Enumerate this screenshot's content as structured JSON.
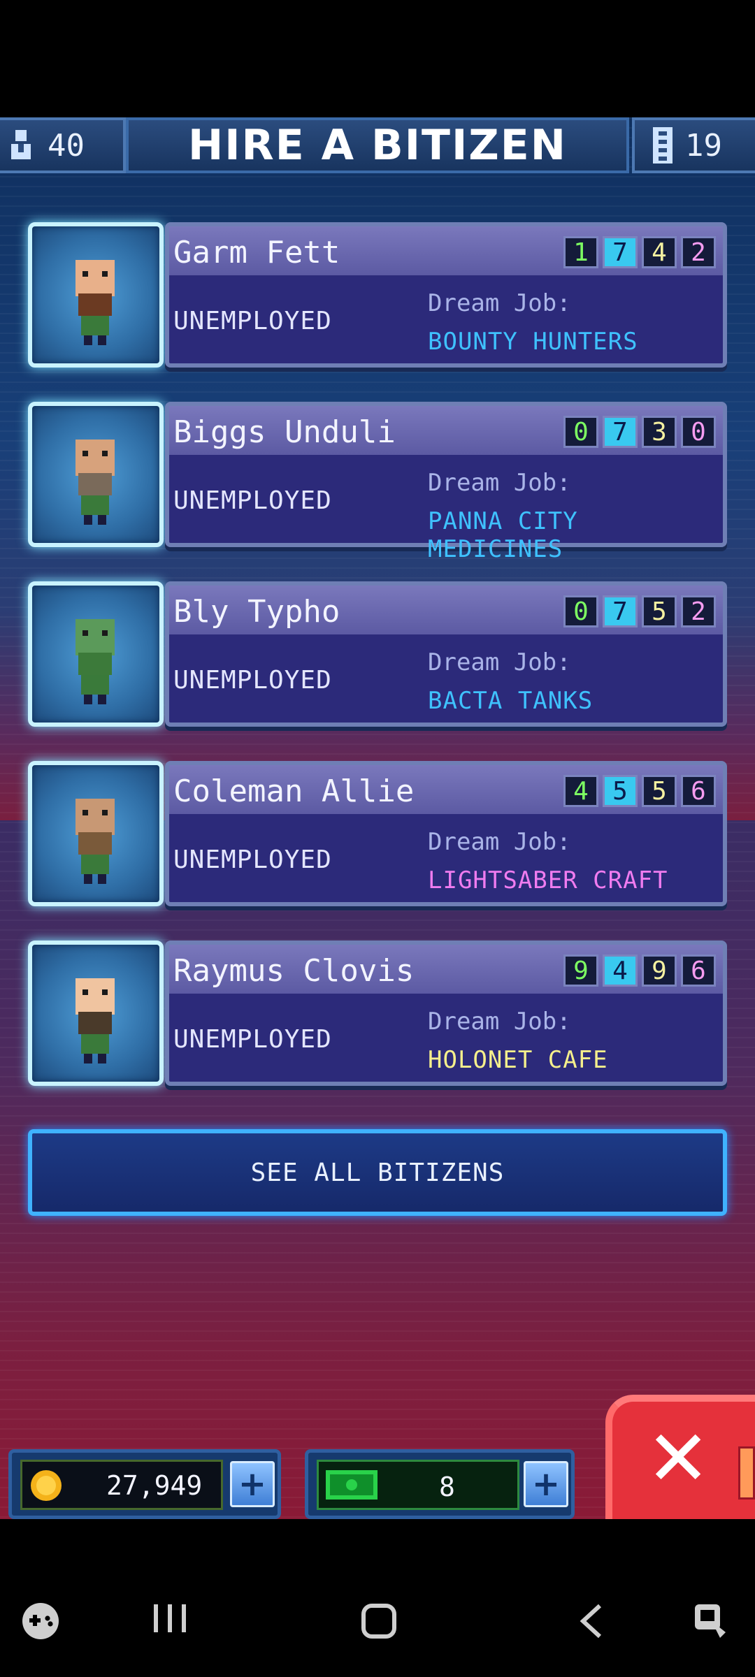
{
  "header": {
    "population": "40",
    "title": "HIRE A BITIZEN",
    "floors": "19"
  },
  "bitizens": [
    {
      "name": "Garm Fett",
      "status": "UNEMPLOYED",
      "dream_label": "Dream Job:",
      "dream_job": "BOUNTY HUNTERS",
      "dream_color": "#3fc2ff",
      "stats": [
        "1",
        "7",
        "4",
        "2"
      ]
    },
    {
      "name": "Biggs Unduli",
      "status": "UNEMPLOYED",
      "dream_label": "Dream Job:",
      "dream_job": "PANNA CITY MEDICINES",
      "dream_color": "#3fc2ff",
      "stats": [
        "0",
        "7",
        "3",
        "0"
      ]
    },
    {
      "name": "Bly Typho",
      "status": "UNEMPLOYED",
      "dream_label": "Dream Job:",
      "dream_job": "BACTA TANKS",
      "dream_color": "#3fc2ff",
      "stats": [
        "0",
        "7",
        "5",
        "2"
      ]
    },
    {
      "name": "Coleman Allie",
      "status": "UNEMPLOYED",
      "dream_label": "Dream Job:",
      "dream_job": "LIGHTSABER CRAFT",
      "dream_color": "#f07cf0",
      "stats": [
        "4",
        "5",
        "5",
        "6"
      ]
    },
    {
      "name": "Raymus Clovis",
      "status": "UNEMPLOYED",
      "dream_label": "Dream Job:",
      "dream_job": "HOLONET CAFE",
      "dream_color": "#f5ef8c",
      "stats": [
        "9",
        "4",
        "9",
        "6"
      ]
    }
  ],
  "see_all_label": "SEE ALL BITIZENS",
  "hud": {
    "coins": "27,949",
    "bux": "8"
  },
  "colors": {
    "accent_cyan": "#39c9f0",
    "close_red": "#e5313b"
  }
}
